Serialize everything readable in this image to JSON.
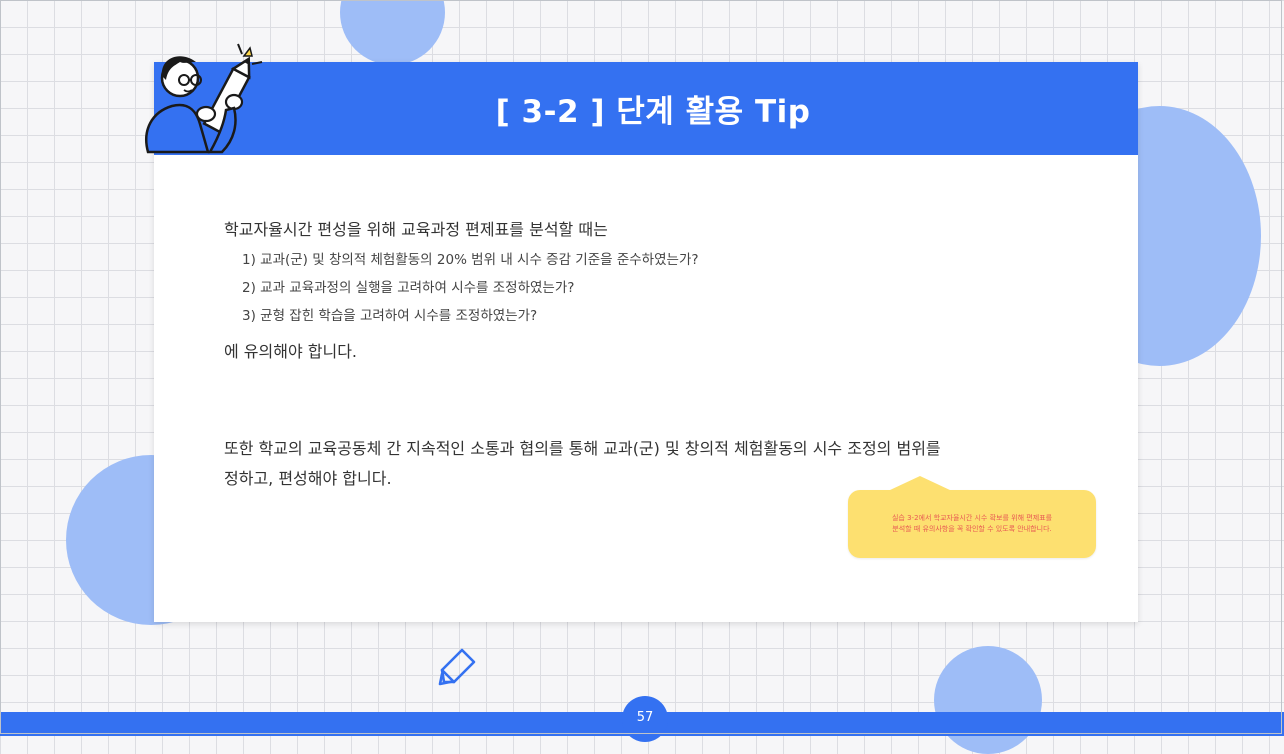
{
  "slide": {
    "title": "[ 3-2 ] 단계 활용 Tip",
    "intro": "학교자율시간 편성을 위해 교육과정 편제표를 분석할 때는",
    "checklist": [
      "1) 교과(군) 및 창의적 체험활동의 20% 범위 내 시수 증감 기준을 준수하였는가?",
      "2) 교과 교육과정의 실행을 고려하여 시수를 조정하였는가?",
      "3) 균형 잡힌 학습을 고려하여 시수를 조정하였는가?"
    ],
    "conclusion": "에  유의해야 합니다.",
    "paragraph2_line1": "또한 학교의 교육공동체 간 지속적인 소통과 협의를 통해 교과(군) 및 창의적 체험활동의 시수 조정의 범위를",
    "paragraph2_line2": "정하고, 편성해야 합니다."
  },
  "note": {
    "line1": "실습 3-2에서 학교자율시간 시수 확보를 위해 편제표를",
    "line2": "분석할 때 유의사항을 꼭 확인할 수 있도록 안내합니다."
  },
  "footer": {
    "page_number": "57"
  },
  "icons": {
    "character": "character-holding-pencil-icon",
    "pencil": "pencil-icon"
  },
  "colors": {
    "primary": "#3471f1",
    "circle": "#9ebdf7",
    "note_bg": "#fde070",
    "note_text": "#e85a53"
  }
}
